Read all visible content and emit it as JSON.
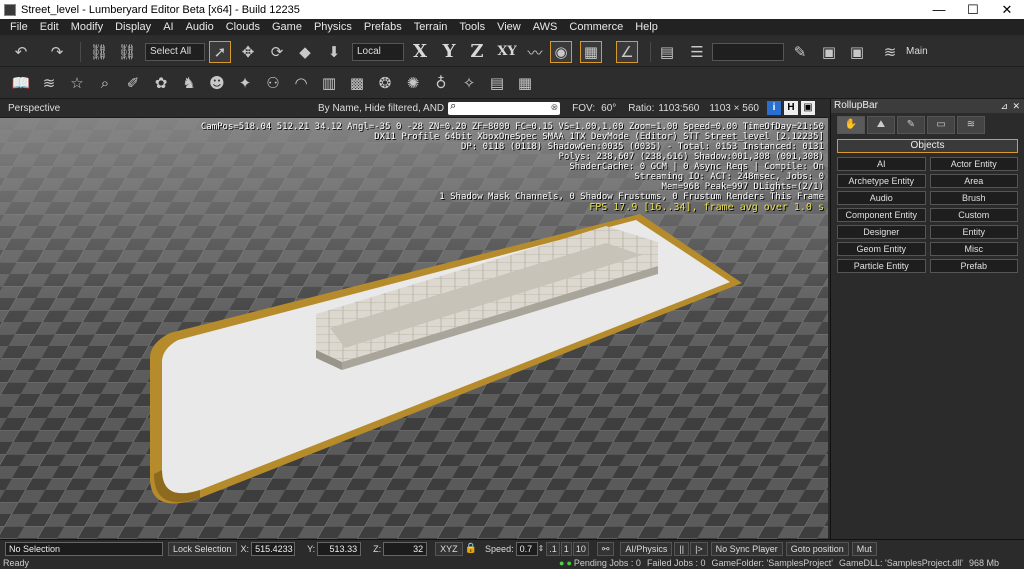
{
  "window": {
    "title": "Street_level - Lumberyard Editor Beta [x64] - Build 12235",
    "minimize_glyph": "—",
    "maximize_glyph": "☐",
    "close_glyph": "✕"
  },
  "menu": [
    "File",
    "Edit",
    "Modify",
    "Display",
    "AI",
    "Audio",
    "Clouds",
    "Game",
    "Physics",
    "Prefabs",
    "Terrain",
    "Tools",
    "View",
    "AWS",
    "Commerce",
    "Help"
  ],
  "toolbar": {
    "select_all": "Select All",
    "coord_system": "Local",
    "axis_x": "X",
    "axis_y": "Y",
    "axis_z": "Z",
    "axis_xy": "XY",
    "layer": "Main"
  },
  "viewport_bar": {
    "name": "Perspective",
    "filter": "By Name, Hide filtered, AND",
    "search_value": "",
    "fov_label": "FOV:",
    "fov_value": "60°",
    "ratio_label": "Ratio:",
    "ratio_value": "1103:560",
    "resolution": "1103 × 560",
    "btn_i": "i",
    "btn_h": "H"
  },
  "hud": {
    "line1": "CamPos=518.04 512.21 34.12 Angl=-35  0 -28 ZN=0.20 ZF=8000 FC=0.15 VS=1.00,1.00 Zoom=1.00 Speed=0.00 TimeOfDay=21:50",
    "line2": "DX11 Profile 64bit XboxOneSpec SMAA 1TX DevMode (Editor) STT Street_level [2.12235]",
    "line3": "DP: 0118 (0118) ShadowGen:0035 (0035) - Total: 0153 Instanced: 0131",
    "line4": "Polys: 238,607 (238,616) Shadow:001,308 (001,308)",
    "line5": "ShaderCache: 0 GCM | 0 Async Reqs | Compile: On",
    "line6": "Streaming IO: ACT: 248msec, Jobs: 0",
    "line7": "Mem=968 Peak=997 DLights=(2/1)",
    "line8": "1 Shadow Mask Channels,   0 Shadow Frustums,   0 Frustum Renders This Frame",
    "fps": "FPS 17.9 [16..34], frame avg over 1.0 s"
  },
  "rollup": {
    "title": "RollupBar",
    "objects_label": "Objects",
    "buttons": [
      "AI",
      "Actor Entity",
      "Archetype Entity",
      "Area",
      "Audio",
      "Brush",
      "Component Entity",
      "Custom",
      "Designer",
      "Entity",
      "Geom Entity",
      "Misc",
      "Particle Entity",
      "Prefab"
    ]
  },
  "status": {
    "selection": "No Selection",
    "lock_selection": "Lock Selection",
    "x_label": "X:",
    "x_value": "515.4233",
    "y_label": "Y:",
    "y_value": "513.33",
    "z_label": "Z:",
    "z_value": "32",
    "xyz": "XYZ",
    "speed_label": "Speed:",
    "speed_value": "0.7",
    "speed_1": ".1",
    "speed_2": "1",
    "speed_3": "10",
    "ai_physics": "AI/Physics",
    "pause": "||",
    "step": "|>",
    "sync_player": "No Sync Player",
    "goto_position": "Goto position",
    "mute": "Mut"
  },
  "bottom": {
    "ready": "Ready",
    "pending_jobs": "Pending Jobs : 0",
    "failed_jobs": "Failed Jobs : 0",
    "game_folder": "GameFolder: 'SamplesProject'",
    "game_dll": "GameDLL: 'SamplesProject.dll'",
    "memory": "968 Mb"
  },
  "colors": {
    "accent": "#d69a2d",
    "fps_text": "#e8e04a",
    "ui_bg": "#2b2b2b"
  }
}
